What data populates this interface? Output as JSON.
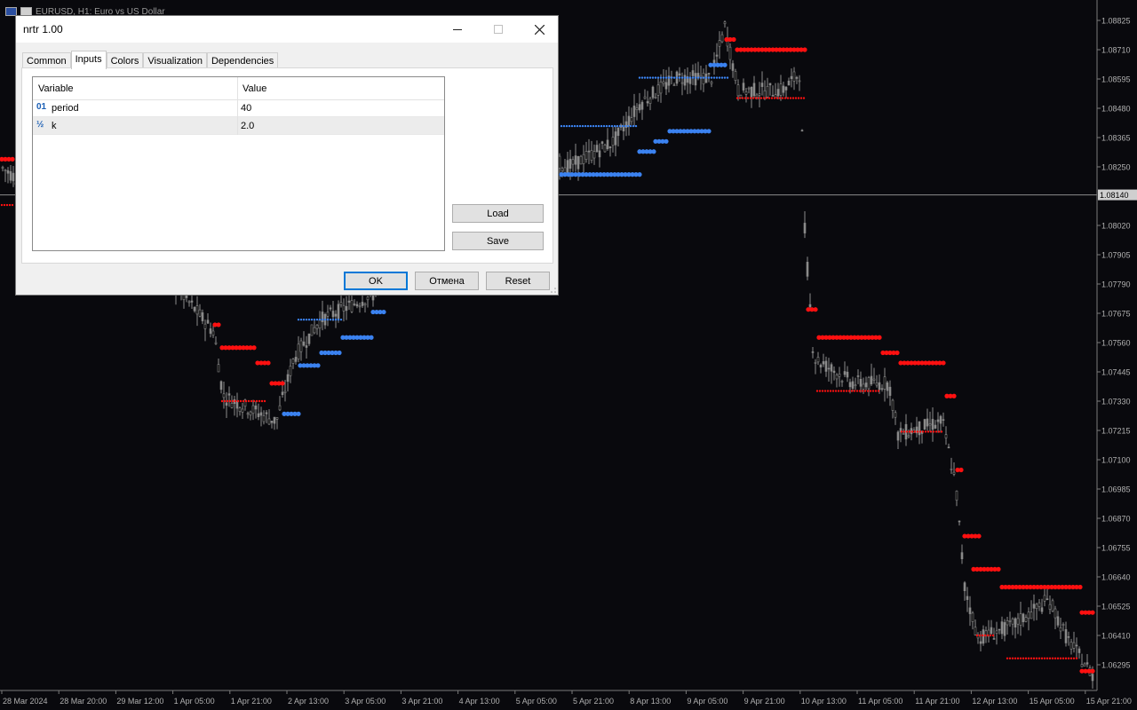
{
  "chart": {
    "title": "EURUSD, H1:  Euro vs US Dollar",
    "current_price": "1.08140",
    "price_axis": [
      "1.08825",
      "1.08710",
      "1.08595",
      "1.08480",
      "1.08365",
      "1.08250",
      "1.08020",
      "1.07905",
      "1.07790",
      "1.07675",
      "1.07560",
      "1.07445",
      "1.07330",
      "1.07215",
      "1.07100",
      "1.06985",
      "1.06870",
      "1.06755",
      "1.06640",
      "1.06525",
      "1.06410",
      "1.06295"
    ],
    "time_axis": [
      "28 Mar 2024",
      "28 Mar 20:00",
      "29 Mar 12:00",
      "1 Apr 05:00",
      "1 Apr 21:00",
      "2 Apr 13:00",
      "3 Apr 05:00",
      "3 Apr 21:00",
      "4 Apr 13:00",
      "5 Apr 05:00",
      "5 Apr 21:00",
      "8 Apr 13:00",
      "9 Apr 05:00",
      "9 Apr 21:00",
      "10 Apr 13:00",
      "11 Apr 05:00",
      "11 Apr 21:00",
      "12 Apr 13:00",
      "15 Apr 05:00",
      "15 Apr 21:00"
    ],
    "colors": {
      "background": "#09090d",
      "up": "#3b82f0",
      "down": "#ff1010",
      "candle": "#8a8a8a",
      "axis_text": "#b0b0b0"
    }
  },
  "dialog": {
    "title": "nrtr 1.00",
    "tabs": [
      {
        "label": "Common"
      },
      {
        "label": "Inputs"
      },
      {
        "label": "Colors"
      },
      {
        "label": "Visualization"
      },
      {
        "label": "Dependencies"
      }
    ],
    "active_tab": "Inputs",
    "table": {
      "col_variable": "Variable",
      "col_value": "Value",
      "rows": [
        {
          "icon": "01",
          "variable": "period",
          "value": "40"
        },
        {
          "icon": "½",
          "variable": "k",
          "value": "2.0"
        }
      ]
    },
    "load_label": "Load",
    "save_label": "Save",
    "ok_label": "OK",
    "cancel_label": "Отмена",
    "reset_label": "Reset"
  }
}
